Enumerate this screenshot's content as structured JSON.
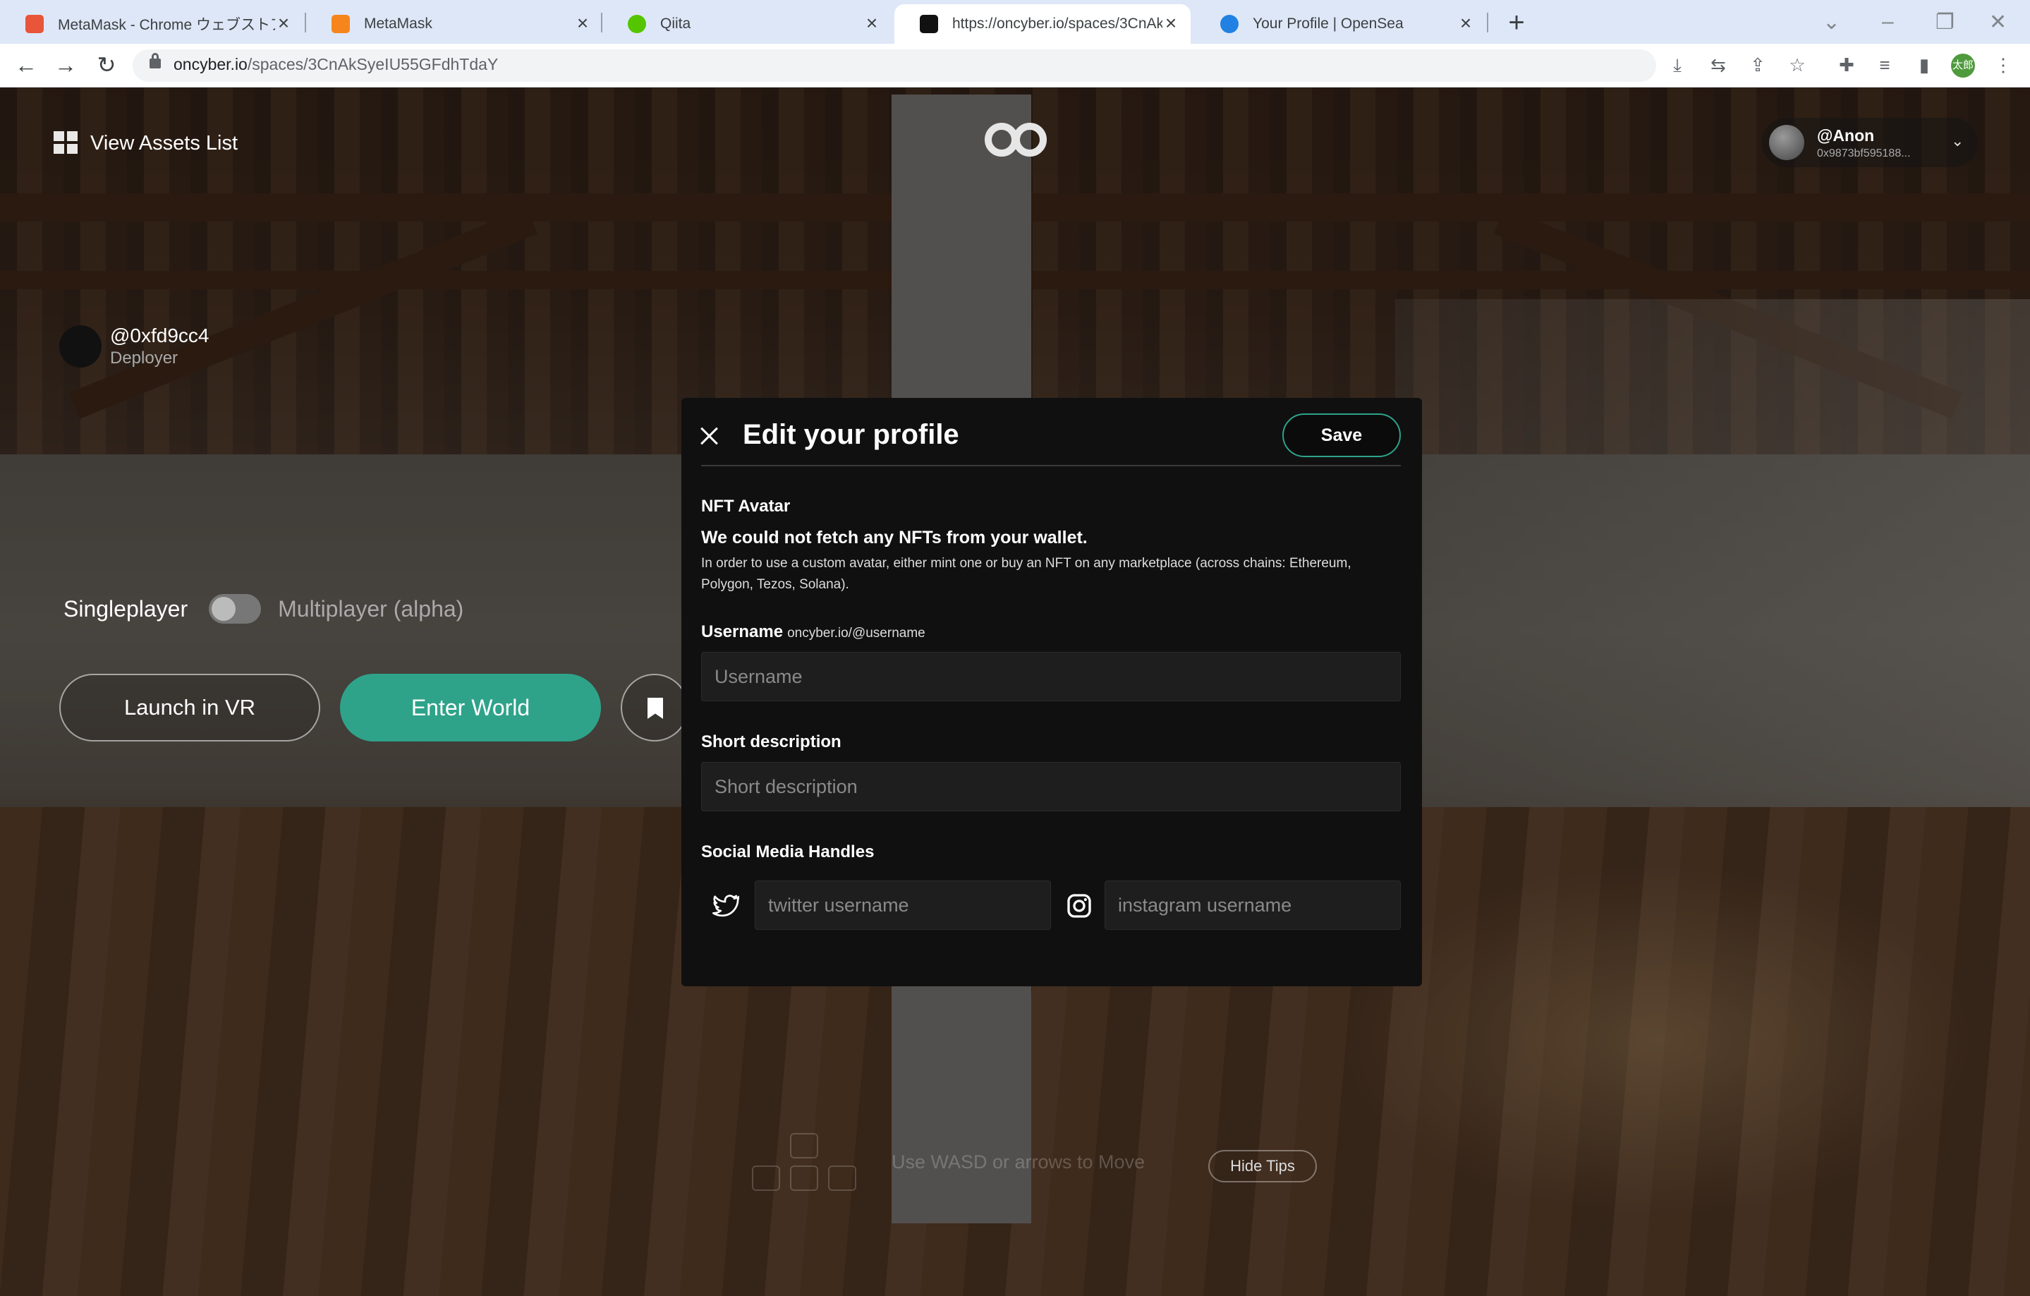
{
  "browser": {
    "tabs": [
      {
        "title": "MetaMask - Chrome ウェブストア",
        "favicon_color": "#e8553a"
      },
      {
        "title": "MetaMask",
        "favicon_color": "#f6851b"
      },
      {
        "title": "Qiita",
        "favicon_color": "#55c500"
      },
      {
        "title": "https://oncyber.io/spaces/3CnAk",
        "favicon_color": "#111111"
      },
      {
        "title": "Your Profile | OpenSea",
        "favicon_color": "#2081e2"
      }
    ],
    "active_tab_index": 3,
    "url_host": "oncyber.io",
    "url_path": "/spaces/3CnAkSyeIU55GFdhTdaY",
    "profile_label": "太郎"
  },
  "scene": {
    "assets_link": "View Assets List",
    "account": {
      "name": "@Anon",
      "address": "0x9873bf595188..."
    },
    "deployer": {
      "name": "@0xfd9cc4",
      "role": "Deployer"
    },
    "mode": {
      "single": "Singleplayer",
      "multi": "Multiplayer (alpha)",
      "multiplayer_on": false
    },
    "launch_vr": "Launch in VR",
    "enter_world": "Enter World",
    "tips_text": "Use WASD or arrows to Move",
    "hide_tips": "Hide Tips",
    "accent_color": "#2ea38a"
  },
  "modal": {
    "title": "Edit your profile",
    "save": "Save",
    "nft_label": "NFT Avatar",
    "nft_warning": "We could not fetch any NFTs from your wallet.",
    "nft_help": "In order to use a custom avatar, either mint one or buy an NFT on any marketplace (across chains: Ethereum, Polygon, Tezos, Solana).",
    "username_label": "Username",
    "username_hint": "oncyber.io/@username",
    "username_placeholder": "Username",
    "desc_label": "Short description",
    "desc_placeholder": "Short description",
    "social_label": "Social Media Handles",
    "twitter_placeholder": "twitter username",
    "instagram_placeholder": "instagram username"
  }
}
